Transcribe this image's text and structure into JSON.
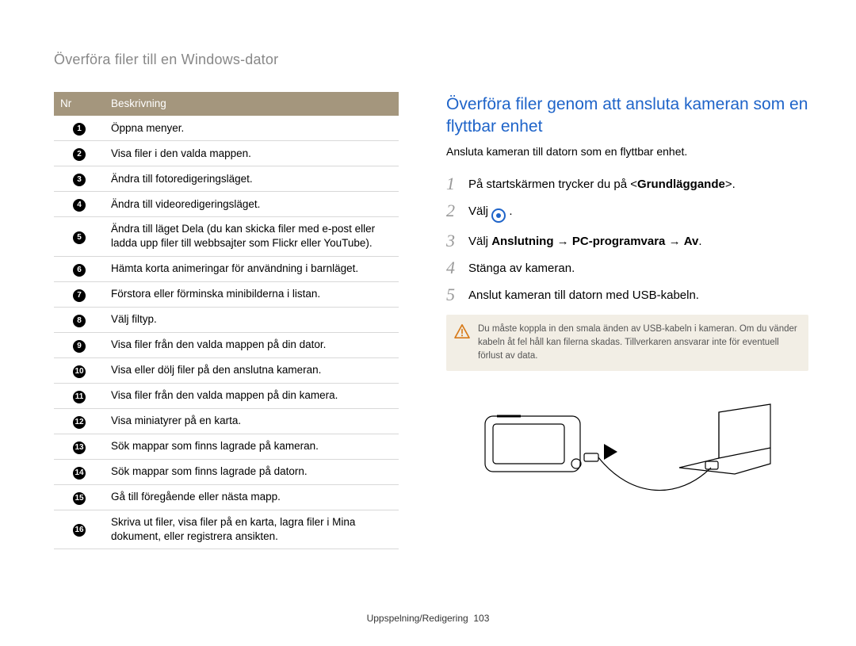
{
  "breadcrumb": "Överföra filer till en Windows-dator",
  "table": {
    "headers": {
      "nr": "Nr",
      "desc": "Beskrivning"
    },
    "rows": [
      "Öppna menyer.",
      "Visa filer i den valda mappen.",
      "Ändra till fotoredigeringsläget.",
      "Ändra till videoredigeringsläget.",
      "Ändra till läget Dela (du kan skicka filer med e-post eller ladda upp filer till webbsajter som Flickr eller YouTube).",
      "Hämta korta animeringar för användning i barnläget.",
      "Förstora eller förminska minibilderna i listan.",
      "Välj filtyp.",
      "Visa filer från den valda mappen på din dator.",
      "Visa eller dölj filer på den anslutna kameran.",
      "Visa filer från den valda mappen på din kamera.",
      "Visa miniatyrer på en karta.",
      "Sök mappar som finns lagrade på kameran.",
      "Sök mappar som finns lagrade på datorn.",
      "Gå till föregående eller nästa mapp.",
      "Skriva ut filer, visa filer på en karta, lagra filer i Mina dokument, eller registrera ansikten."
    ]
  },
  "section": {
    "title": "Överföra filer genom att ansluta kameran som en flyttbar enhet",
    "subtitle": "Ansluta kameran till datorn som en flyttbar enhet."
  },
  "steps": {
    "s1_pre": "På startskärmen trycker du på <",
    "s1_bold": "Grundläggande",
    "s1_post": ">.",
    "s2_pre": "Välj ",
    "s2_post": " .",
    "s3_pre": "Välj ",
    "s3_b1": "Anslutning",
    "s3_arr1": " → ",
    "s3_b2": "PC-programvara",
    "s3_arr2": " → ",
    "s3_b3": "Av",
    "s3_post": ".",
    "s4": "Stänga av kameran.",
    "s5": "Anslut kameran till datorn med USB-kabeln."
  },
  "note": "Du måste koppla in den smala änden av USB-kabeln i kameran. Om du vänder kabeln åt fel håll kan filerna skadas. Tillverkaren ansvarar inte för eventuell förlust av data.",
  "footer": {
    "label": "Uppspelning/Redigering",
    "page": "103"
  }
}
